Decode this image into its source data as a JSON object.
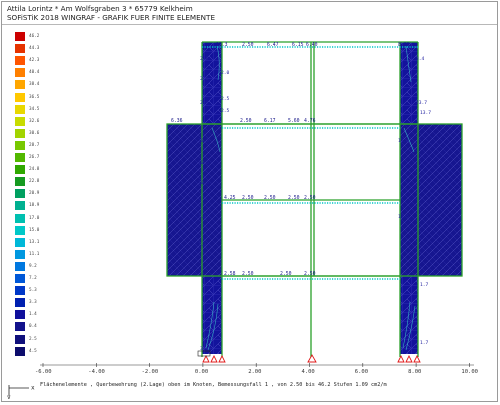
{
  "header": {
    "line1": "Attila Lorintz * Am Wolfsgraben 3 * 65779 Kelkheim",
    "line2": "SOFiSTiK 2018   WINGRAF - GRAFIK FUER FINITE ELEMENTE"
  },
  "legend": {
    "values": [
      "46.2",
      "44.3",
      "42.3",
      "40.4",
      "38.4",
      "36.5",
      "34.5",
      "32.6",
      "30.6",
      "28.7",
      "26.7",
      "24.8",
      "22.8",
      "20.9",
      "18.9",
      "17.0",
      "15.0",
      "13.1",
      "11.1",
      "9.2",
      "7.2",
      "5.3",
      "3.3",
      "1.4",
      "0.4",
      "2.5",
      "4.5"
    ]
  },
  "axis": {
    "ticks": [
      "-6.00",
      "-4.00",
      "-2.00",
      "0.00",
      "2.00",
      "4.00",
      "6.00",
      "8.00",
      "10.00"
    ],
    "corner_labels": [
      "x",
      "y"
    ]
  },
  "annotations": {
    "top_beam": [
      "18.3",
      "2.50",
      "6.47",
      "6.15",
      "6.40",
      "8.91"
    ],
    "beam_2": [
      "6.36",
      "2.50",
      "6.17",
      "5.60",
      "4.76"
    ],
    "beam_3": [
      "4.25",
      "2.50",
      "2.50",
      "2.50",
      "2.50"
    ],
    "beam_4": [
      "2.58",
      "2.50",
      "2.50",
      "2.50"
    ],
    "markers": [
      "2.8",
      "2.8",
      "2.0",
      "2.0",
      "2.5",
      "2.5",
      "10.5",
      "10.5",
      "10.5",
      "7.9",
      "7.9",
      "3.4",
      "23.7",
      "13.7",
      "40.0",
      "31.3",
      "31.3",
      "1.7",
      "1.7",
      "11.8",
      "11.5"
    ]
  },
  "footer": {
    "description": "Flächenelemente , Querbewehrung (2.Lage) oben im Knoten, Bemessungsfall 1   , von 2.50 bis 46.2 Stufen 1.09 cm2/m"
  },
  "colors": {
    "frame_line": "#2aa02a",
    "wall_fill": "#13139c",
    "beam_dots": "#00c6c6",
    "support": "#e01818",
    "text_blue": "#1a1a8a"
  }
}
